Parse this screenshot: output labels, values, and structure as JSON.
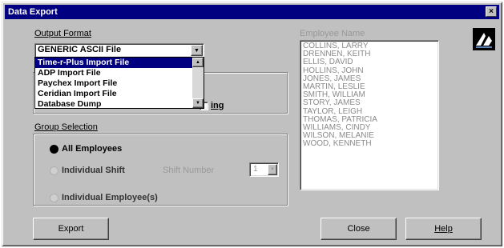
{
  "window": {
    "title": "Data Export",
    "close_glyph": "×"
  },
  "output_format": {
    "label": "Output Format",
    "selected": "GENERIC ASCII File",
    "options": [
      "Time-r-Plus Import File",
      "ADP Import File",
      "Paychex Import File",
      "Ceridian Import File",
      "Database Dump"
    ],
    "selected_option_index": 0
  },
  "hidden_checkbox_label_tail": "ing",
  "group_selection": {
    "label": "Group Selection",
    "all_employees": "All Employees",
    "individual_shift": "Individual Shift",
    "shift_number_label": "Shift Number",
    "shift_number_value": "1",
    "individual_employees": "Individual Employee(s)",
    "selected": "all_employees"
  },
  "employee_names": {
    "label": "Employee Name",
    "items": [
      "COLLINS, LARRY",
      "DRENNEN, KEITH",
      "ELLIS, DAVID",
      "HOLLINS, JOHN",
      "JONES, JAMES",
      "MARTIN, LESLIE",
      "SMITH, WILLIAM",
      "STORY, JAMES",
      "TAYLOR, LEIGH",
      "THOMAS, PATRICIA",
      "WILLIAMS, CINDY",
      "WILSON, MELANIE",
      "WOOD, KENNETH"
    ]
  },
  "buttons": {
    "export": "Export",
    "close": "Close",
    "help": "Help"
  },
  "icons": {
    "combo_arrow": "chevron-down-icon",
    "logo": "app-logo-icon"
  },
  "colors": {
    "title_bar": "#000080",
    "selection": "#000080",
    "face": "#c0c0c0"
  }
}
